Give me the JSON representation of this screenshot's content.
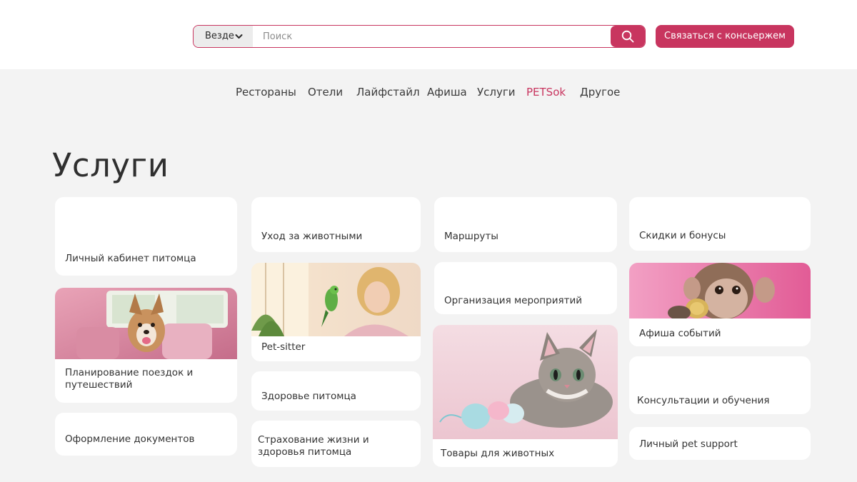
{
  "search": {
    "scope_label": "Везде",
    "placeholder": "Поиск",
    "value": ""
  },
  "concierge_button": "Связаться с консьержем",
  "nav": [
    {
      "label": "Рестораны"
    },
    {
      "label": "Отели"
    },
    {
      "label": "Лайфстайл"
    },
    {
      "label": "Афиша"
    },
    {
      "label": "Услуги"
    },
    {
      "label": "PETSok",
      "active": true
    },
    {
      "label": "Другое"
    }
  ],
  "page_title": "Услуги",
  "cards": {
    "personal_account": "Личный кабинет питомца",
    "trip_planning": "Планирование поездок и путешествий",
    "documents": "Оформление документов",
    "animal_care": "Уход за животными",
    "pet_sitter": "Pet-sitter",
    "pet_health": "Здоровье питомца",
    "insurance": "Страхование жизни и здоровья питомца",
    "routes": "Маршруты",
    "events_org": "Организация мероприятий",
    "pet_goods": "Товары для животных",
    "discounts": "Скидки и бонусы",
    "events_poster": "Афиша событий",
    "consultations": "Консультации и обучения",
    "pet_support": "Личный pet support"
  },
  "colors": {
    "accent": "#c8355f",
    "background": "#f3f3f3",
    "card": "#ffffff",
    "text": "#3a3a3a"
  },
  "icons": {
    "search": "search-icon",
    "dropdown": "chevron-down-icon"
  }
}
